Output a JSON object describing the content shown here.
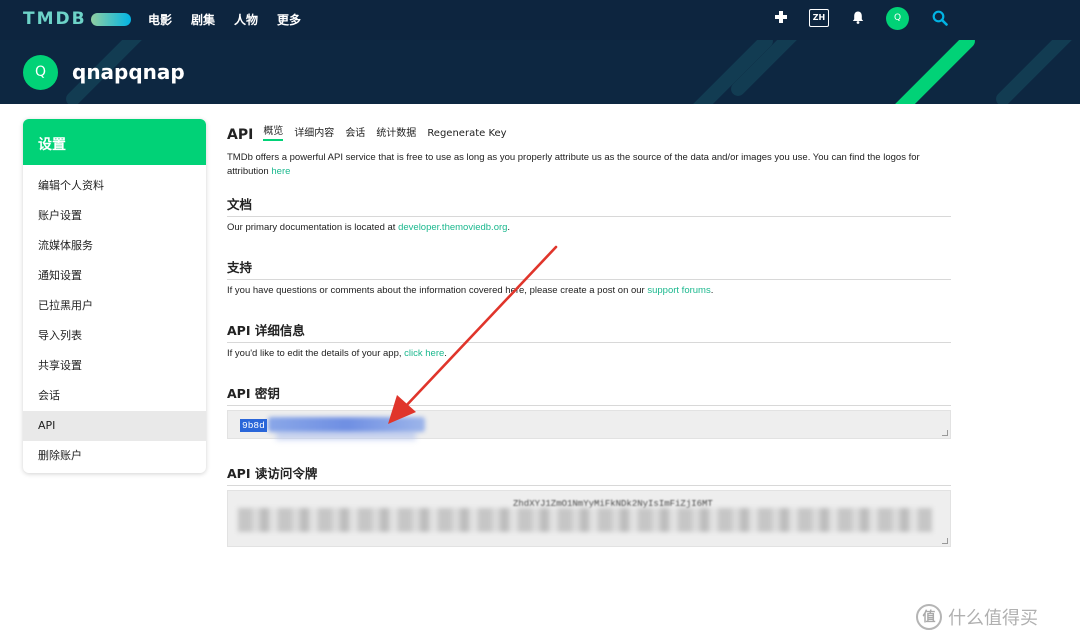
{
  "topbar": {
    "logo": "TMDB",
    "nav": [
      "电影",
      "剧集",
      "人物",
      "更多"
    ],
    "lang": "ZH",
    "avatar_initial": "Q"
  },
  "profile": {
    "avatar_initial": "Q",
    "username": "qnapqnap"
  },
  "sidebar": {
    "header": "设置",
    "items": [
      {
        "label": "编辑个人资料"
      },
      {
        "label": "账户设置"
      },
      {
        "label": "流媒体服务"
      },
      {
        "label": "通知设置"
      },
      {
        "label": "已拉黑用户"
      },
      {
        "label": "导入列表"
      },
      {
        "label": "共享设置"
      },
      {
        "label": "会话"
      },
      {
        "label": "API"
      },
      {
        "label": "删除账户"
      }
    ]
  },
  "content": {
    "title": "API",
    "tabs": [
      "概览",
      "详细内容",
      "会话",
      "统计数据",
      "Regenerate Key"
    ],
    "intro_text": "TMDb offers a powerful API service that is free to use as long as you properly attribute us as the source of the data and/or images you use. You can find the logos for attribution",
    "intro_link": "here",
    "docs": {
      "title": "文档",
      "text": "Our primary documentation is located at",
      "link": "developer.themoviedb.org"
    },
    "support": {
      "title": "支持",
      "text": "If you have questions or comments about the information covered here, please create a post on our",
      "link": "support forums"
    },
    "details": {
      "title": "API 详细信息",
      "text": "If you'd like to edit the details of your app,",
      "link": "click here"
    },
    "api_key": {
      "title": "API 密钥",
      "value_visible": "9b8d"
    },
    "token": {
      "title": "API 读访问令牌",
      "value_visible": "ZhdXYJ1ZmO1NmYyMiFkNDk2NyIsImFiZjI6MT"
    }
  },
  "watermark": {
    "icon": "值",
    "text": "什么值得买"
  },
  "colors": {
    "nav_bg": "#0d253f",
    "accent_green": "#01d277",
    "link": "#1bb88e",
    "selection": "#2a66d9",
    "arrow": "#e0352b"
  }
}
